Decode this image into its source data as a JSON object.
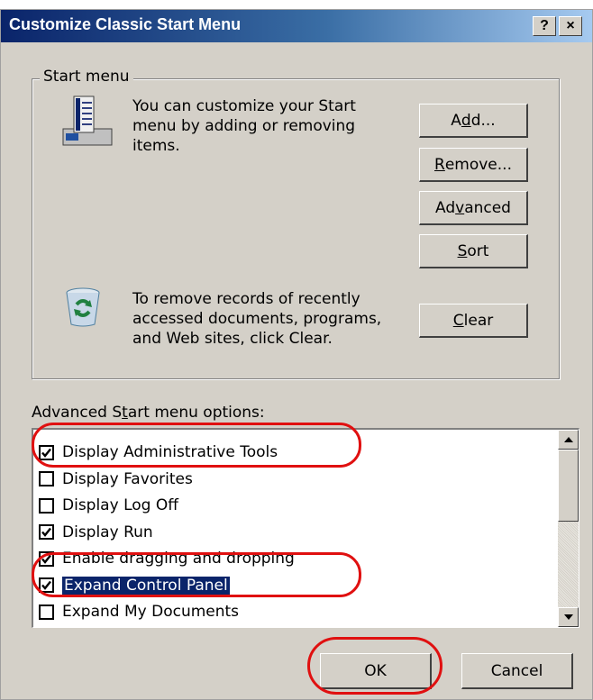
{
  "window": {
    "title": "Customize Classic Start Menu",
    "help_button": "?",
    "close_button": "×"
  },
  "start_menu_group": {
    "label": "Start menu",
    "customize_text": "You can customize your Start\nmenu by adding or removing\nitems.",
    "clear_text": "To remove records of recently\naccessed documents, programs,\nand Web sites, click Clear.",
    "buttons": {
      "add": {
        "before": "A",
        "mnemonic": "d",
        "after": "d..."
      },
      "remove": {
        "before": "",
        "mnemonic": "R",
        "after": "emove..."
      },
      "advanced": {
        "before": "Ad",
        "mnemonic": "v",
        "after": "anced"
      },
      "sort": {
        "before": "",
        "mnemonic": "S",
        "after": "ort"
      },
      "clear": {
        "before": "",
        "mnemonic": "C",
        "after": "lear"
      }
    }
  },
  "advanced_options": {
    "label_before": "Advanced S",
    "label_mnemonic": "t",
    "label_after": "art menu options:",
    "items": [
      {
        "label": "Display Administrative Tools",
        "checked": true
      },
      {
        "label": "Display Favorites",
        "checked": false
      },
      {
        "label": "Display Log Off",
        "checked": false
      },
      {
        "label": "Display Run",
        "checked": true
      },
      {
        "label": "Enable dragging and dropping",
        "checked": true
      },
      {
        "label": "Expand Control Panel",
        "checked": true,
        "selected": true
      },
      {
        "label": "Expand My Documents",
        "checked": false
      }
    ]
  },
  "footer": {
    "ok_label": "OK",
    "cancel_label": "Cancel"
  },
  "annotation_color": "#e01010"
}
